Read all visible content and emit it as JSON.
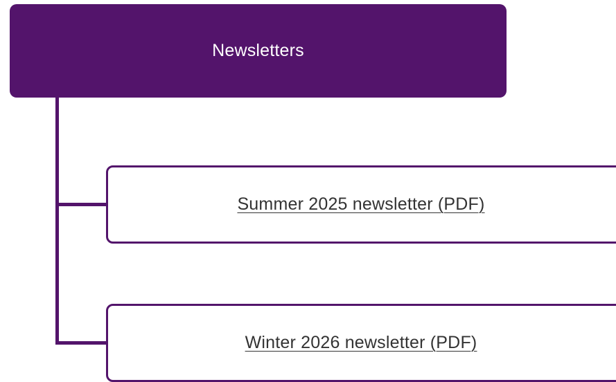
{
  "colors": {
    "accent": "#53146b",
    "link_text": "#333333",
    "background": "#ffffff"
  },
  "tree": {
    "root": {
      "label": "Newsletters"
    },
    "children": [
      {
        "label": "Summer 2025 newsletter (PDF)",
        "icon": "pdf-file"
      },
      {
        "label": "Winter 2026 newsletter (PDF)",
        "icon": "pdf-file"
      }
    ]
  }
}
